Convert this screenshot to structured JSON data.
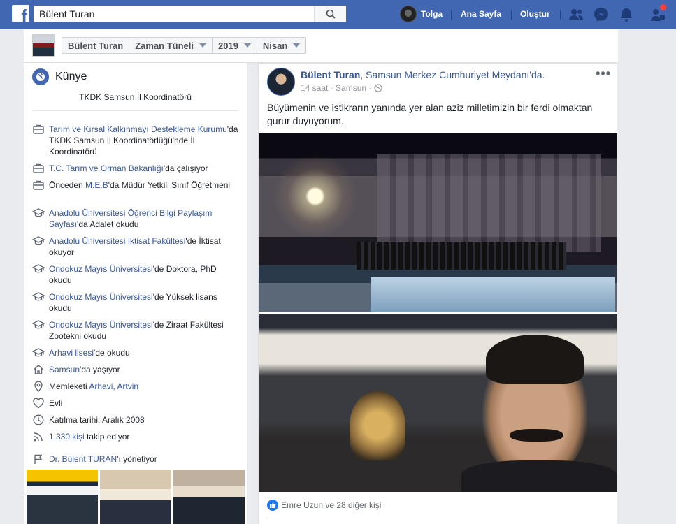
{
  "topbar": {
    "logo": "f",
    "search_value": "Bülent Turan",
    "user_name": "Tolga",
    "home_label": "Ana Sayfa",
    "create_label": "Oluştur",
    "colors": {
      "bar": "#4267b2",
      "notification": "#fa3e3e"
    }
  },
  "breadcrumbs": [
    "Bülent Turan",
    "Zaman Tüneli",
    "2019",
    "Nisan"
  ],
  "left": {
    "section_title": "Künye",
    "bio": "TKDK Samsun İl Koordinatörü",
    "items": [
      {
        "icon": "briefcase-icon",
        "link": "Tarım ve Kırsal Kalkınmayı Destekleme Kurumu",
        "text": "'da TKDK Samsun İl Koordinatörlüğü'nde İl Koordinatörü"
      },
      {
        "icon": "briefcase-icon",
        "link": "T.C. Tarım ve Orman Bakanlığı",
        "text": "'da çalışıyor"
      },
      {
        "icon": "briefcase-icon",
        "pre": "Önceden ",
        "link": "M.E.B",
        "text": "'da Müdür Yetkili Sınıf Öğretmeni"
      },
      {
        "icon": "graduation-cap-icon",
        "link": "Anadolu Üniversitesi Öğrenci Bilgi Paylaşım Sayfası",
        "text": "'da Adalet okudu"
      },
      {
        "icon": "graduation-cap-icon",
        "link": "Anadolu Üniversitesi Iktisat Fakültesi",
        "text": "'de İktisat okuyor"
      },
      {
        "icon": "graduation-cap-icon",
        "link": "Ondokuz Mayıs Üniversitesi",
        "text": "'de Doktora, PhD okudu"
      },
      {
        "icon": "graduation-cap-icon",
        "link": "Ondokuz Mayıs Üniversitesi",
        "text": "'de Yüksek lisans okudu"
      },
      {
        "icon": "graduation-cap-icon",
        "link": "Ondokuz Mayıs Üniversitesi",
        "text": "'de Ziraat Fakültesi Zootekni okudu"
      },
      {
        "icon": "graduation-cap-icon",
        "link": "Arhavi lisesi",
        "text": "'de okudu"
      },
      {
        "icon": "home-icon",
        "link": "Samsun",
        "text": "'da yaşıyor"
      },
      {
        "icon": "location-pin-icon",
        "pre": "Memleketi ",
        "link": "Arhavi, Artvin",
        "text": ""
      },
      {
        "icon": "heart-icon",
        "pre": "Evli",
        "link": "",
        "text": ""
      },
      {
        "icon": "clock-icon",
        "pre": "Katılma tarihi: Aralık 2008",
        "link": "",
        "text": ""
      },
      {
        "icon": "rss-icon",
        "link": "1.330 kişi",
        "text": " takip ediyor"
      },
      {
        "icon": "flag-icon",
        "link": "Dr. Bülent TURAN",
        "text": "'ı yönetiyor"
      }
    ]
  },
  "post": {
    "author": "Bülent Turan",
    "place": "Samsun Merkez Cumhuriyet Meydanı",
    "place_suffix": "'da.",
    "time": "14 saat",
    "location": "Samsun",
    "text": "Büyümenin ve istikrarın yanında yer alan aziz milletimizin bir ferdi olmaktan gurur duyuyorum.",
    "reactions": "Emre Uzun ve 28 diğer kişi"
  }
}
